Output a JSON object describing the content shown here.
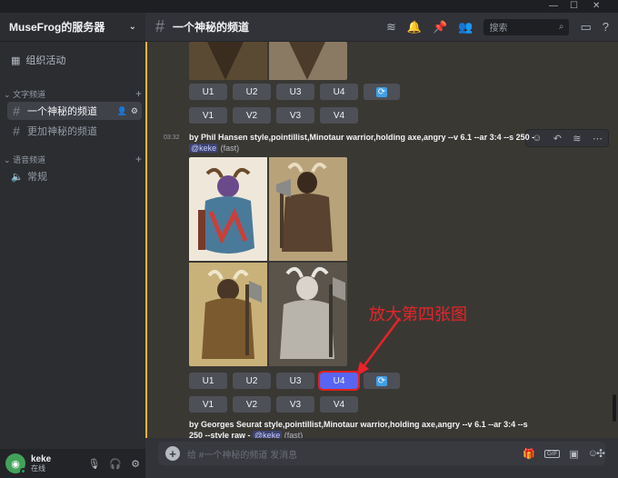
{
  "server": {
    "name": "MuseFrog的服务器"
  },
  "sidebar": {
    "events_label": "组织活动",
    "text_category": "文字频道",
    "voice_category": "语音频道",
    "channels": [
      {
        "name": "一个神秘的频道"
      },
      {
        "name": "更加神秘的频道"
      }
    ],
    "voice_channels": [
      {
        "name": "常规"
      }
    ]
  },
  "user": {
    "name": "keke",
    "status": "在线"
  },
  "header": {
    "channel_name": "一个神秘的频道",
    "search_placeholder": "搜索"
  },
  "upscale_buttons": [
    "U1",
    "U2",
    "U3",
    "U4"
  ],
  "variation_buttons": [
    "V1",
    "V2",
    "V3",
    "V4"
  ],
  "messages": [
    {
      "time": "03:32",
      "prompt": "by Phil Hansen style,pointillist,Minotaur warrior,holding axe,angry --v 6.1 --ar 3:4 --s 250",
      "mention": "@keke",
      "mode": "(fast)"
    },
    {
      "prompt": "by Georges Seurat style,pointillist,Minotaur warrior,holding axe,angry --v 6.1 --ar 3:4 --s",
      "prompt_cont": "250 --style raw",
      "mention": "@keke",
      "mode": "(fast)"
    }
  ],
  "annotation": "放大第四张图",
  "composer": {
    "placeholder": "给 #一个神秘的频道 发消息"
  },
  "colors": {
    "accent": "#5865f2",
    "highlight": "#e0201c",
    "mention_bar": "#f0b232"
  }
}
